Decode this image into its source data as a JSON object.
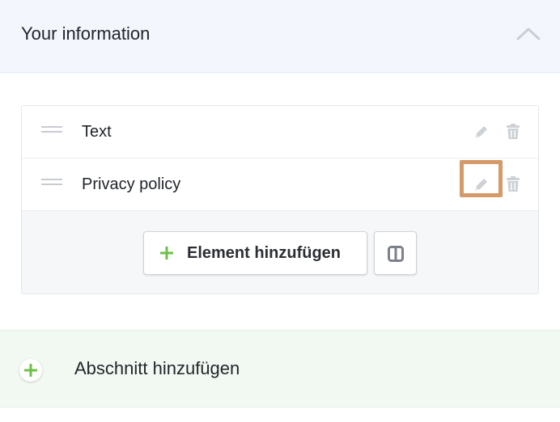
{
  "section": {
    "title": "Your information"
  },
  "rows": [
    {
      "label": "Text"
    },
    {
      "label": "Privacy policy"
    }
  ],
  "card_footer": {
    "add_element_label": "Element hinzufügen"
  },
  "add_section": {
    "label": "Abschnitt hinzufügen"
  },
  "icons": {
    "collapse": "chevron-up-icon",
    "drag": "drag-handle-icon",
    "edit": "pencil-icon",
    "delete": "trash-icon",
    "add": "plus-icon",
    "layout": "columns-icon"
  },
  "colors": {
    "header_bg": "#f3f7fd",
    "add_section_bg": "#f2f9f2",
    "plus_green": "#6cc04a",
    "highlight": "#d49a6a",
    "icon_gray": "#c9ccd1"
  }
}
